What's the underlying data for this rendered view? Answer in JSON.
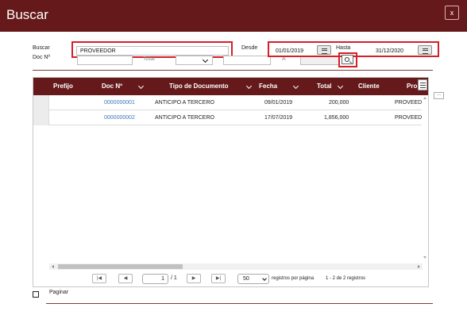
{
  "window": {
    "title": "Buscar",
    "close_label": "x"
  },
  "filters": {
    "buscar_label": "Buscar",
    "buscar_value": "PROVEEDOR",
    "doc_label": "Doc Nº",
    "desde_label": "Desde",
    "desde_value": "01/01/2019",
    "hasta_label": "Hasta",
    "hasta_value": "31/12/2020",
    "total_label": "Total",
    "a_label": "A"
  },
  "grid": {
    "columns": [
      "Prefijo",
      "Doc Nº",
      "Tipo de Documento",
      "Fecha",
      "Total",
      "Cliente",
      "Pro"
    ],
    "rows": [
      {
        "doc": "0000000001",
        "tipo": "ANTICIPO A TERCERO",
        "fecha": "09/01/2019",
        "total": "200,000",
        "pro": "PROVEEDO"
      },
      {
        "doc": "0000000002",
        "tipo": "ANTICIPO A TERCERO",
        "fecha": "17/07/2019",
        "total": "1,856,000",
        "pro": "PROVEEDO"
      }
    ]
  },
  "pager": {
    "page": "1",
    "of": "/ 1",
    "page_size": "50",
    "per_page_label": "registros por página",
    "summary": "1 - 2 de 2 registros"
  },
  "footer": {
    "paginar_label": "Paginar"
  },
  "side_button_label": "...",
  "colors": {
    "brand": "#65191a",
    "highlight": "#d61f26",
    "link": "#3d76b5"
  }
}
